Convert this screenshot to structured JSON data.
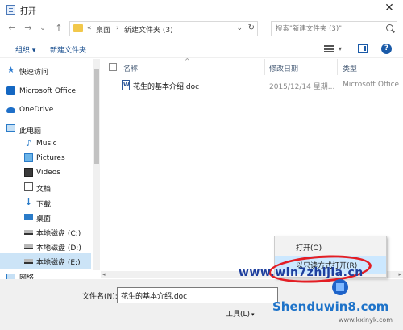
{
  "window": {
    "title": "打开",
    "close_symbol": "✕"
  },
  "nav": {
    "back": "←",
    "forward": "→",
    "dropdown": "⌄",
    "up": "↑"
  },
  "address": {
    "overflow": "«",
    "seg1": "桌面",
    "sep": "›",
    "seg2": "新建文件夹 (3)",
    "dropdown": "⌄",
    "refresh": "↻"
  },
  "search": {
    "placeholder": "搜索\"新建文件夹 (3)\""
  },
  "toolbar": {
    "organize": "组织 ▾",
    "new_folder": "新建文件夹",
    "view_dropdown": "▾",
    "help": "?"
  },
  "sidebar": {
    "items": [
      {
        "label": "快速访问",
        "icon": "star-icon"
      },
      {
        "label": "Microsoft Office",
        "icon": "outlook-icon"
      },
      {
        "label": "OneDrive",
        "icon": "cloud-icon"
      },
      {
        "label": "此电脑",
        "icon": "computer-icon"
      },
      {
        "label": "Music",
        "icon": "music-icon"
      },
      {
        "label": "Pictures",
        "icon": "pictures-icon"
      },
      {
        "label": "Videos",
        "icon": "videos-icon"
      },
      {
        "label": "文档",
        "icon": "documents-icon"
      },
      {
        "label": "下载",
        "icon": "download-icon"
      },
      {
        "label": "桌面",
        "icon": "desktop-icon"
      },
      {
        "label": "本地磁盘 (C:)",
        "icon": "drive-icon"
      },
      {
        "label": "本地磁盘 (D:)",
        "icon": "drive-icon"
      },
      {
        "label": "本地磁盘 (E:)",
        "icon": "drive-icon",
        "selected": true
      },
      {
        "label": "网络",
        "icon": "network-icon"
      }
    ]
  },
  "files": {
    "headers": {
      "name": "名称",
      "modified": "修改日期",
      "type": "类型",
      "sort_indicator": "^"
    },
    "rows": [
      {
        "name": "花生的基本介绍.doc",
        "modified": "2015/12/14 星期...",
        "type": "Microsoft Office"
      }
    ]
  },
  "bottom": {
    "filename_label": "文件名(N):",
    "filename_value": "花生的基本介绍.doc",
    "tools": "工具(L)",
    "tools_caret": "▾"
  },
  "open_menu": {
    "items": [
      {
        "label": "打开(O)"
      },
      {
        "label": "以只读方式打开(R)"
      }
    ]
  },
  "watermarks": {
    "site1": "www.win7zhijia.cn",
    "site2": "Shenduwin8.com",
    "site3": "www.kxinyk.com"
  },
  "scrollbar": {
    "left": "◂",
    "right": "▸"
  },
  "colors": {
    "accent": "#1a5aa8",
    "selection": "#cce4f7",
    "annotation_ring": "#e31e24"
  }
}
